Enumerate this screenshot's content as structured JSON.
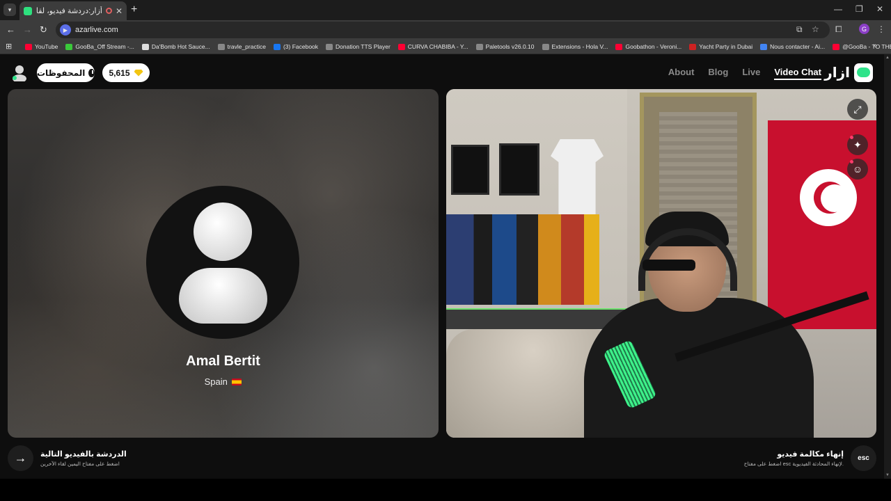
{
  "browser": {
    "tab_title": "أزار:دردشة فيديو، لقاء الأصدقاء",
    "url": "azarlive.com",
    "bookmarks": [
      {
        "label": "YouTube",
        "color": "#ff0033"
      },
      {
        "label": "GooBa_Off Stream -...",
        "color": "#3ac93a"
      },
      {
        "label": "Da'Bomb Hot Sauce...",
        "color": "#dddddd"
      },
      {
        "label": "travle_practice",
        "color": "#888888"
      },
      {
        "label": "(3) Facebook",
        "color": "#1877f2"
      },
      {
        "label": "Donation TTS Player",
        "color": "#888888"
      },
      {
        "label": "CURVA CHABIBA - Y...",
        "color": "#ff0033"
      },
      {
        "label": "Paletools v26.0.10",
        "color": "#888888"
      },
      {
        "label": "Extensions - Hola V...",
        "color": "#888888"
      },
      {
        "label": "Goobathon - Veroni...",
        "color": "#ff0033"
      },
      {
        "label": "Yacht Party in Dubai",
        "color": "#cc2222"
      },
      {
        "label": "Nous contacter - Ai...",
        "color": "#4285f4"
      },
      {
        "label": "@GooBa - TO THE...",
        "color": "#ff0033"
      }
    ]
  },
  "header": {
    "saved_label": "المحفوظات",
    "gems_count": "5,615",
    "nav": [
      "About",
      "Blog",
      "Live",
      "Video Chat"
    ],
    "active_nav": "Video Chat",
    "logo_text": "ازار"
  },
  "peer": {
    "name": "Amal Bertit",
    "country": "Spain"
  },
  "controls": {
    "next_title": "الدردشة بالفيديو التالية",
    "next_sub": "اضغط على مفتاح اليمين لقاء الآخرين",
    "end_title": "إنهاء مكالمة فيديو",
    "end_sub": "اضغط على مفتاح esc لإنهاء المحادثة الفيديوية.",
    "esc_label": "esc"
  },
  "colors": {
    "accent": "#2fe38a",
    "gem": "#f2c512"
  }
}
